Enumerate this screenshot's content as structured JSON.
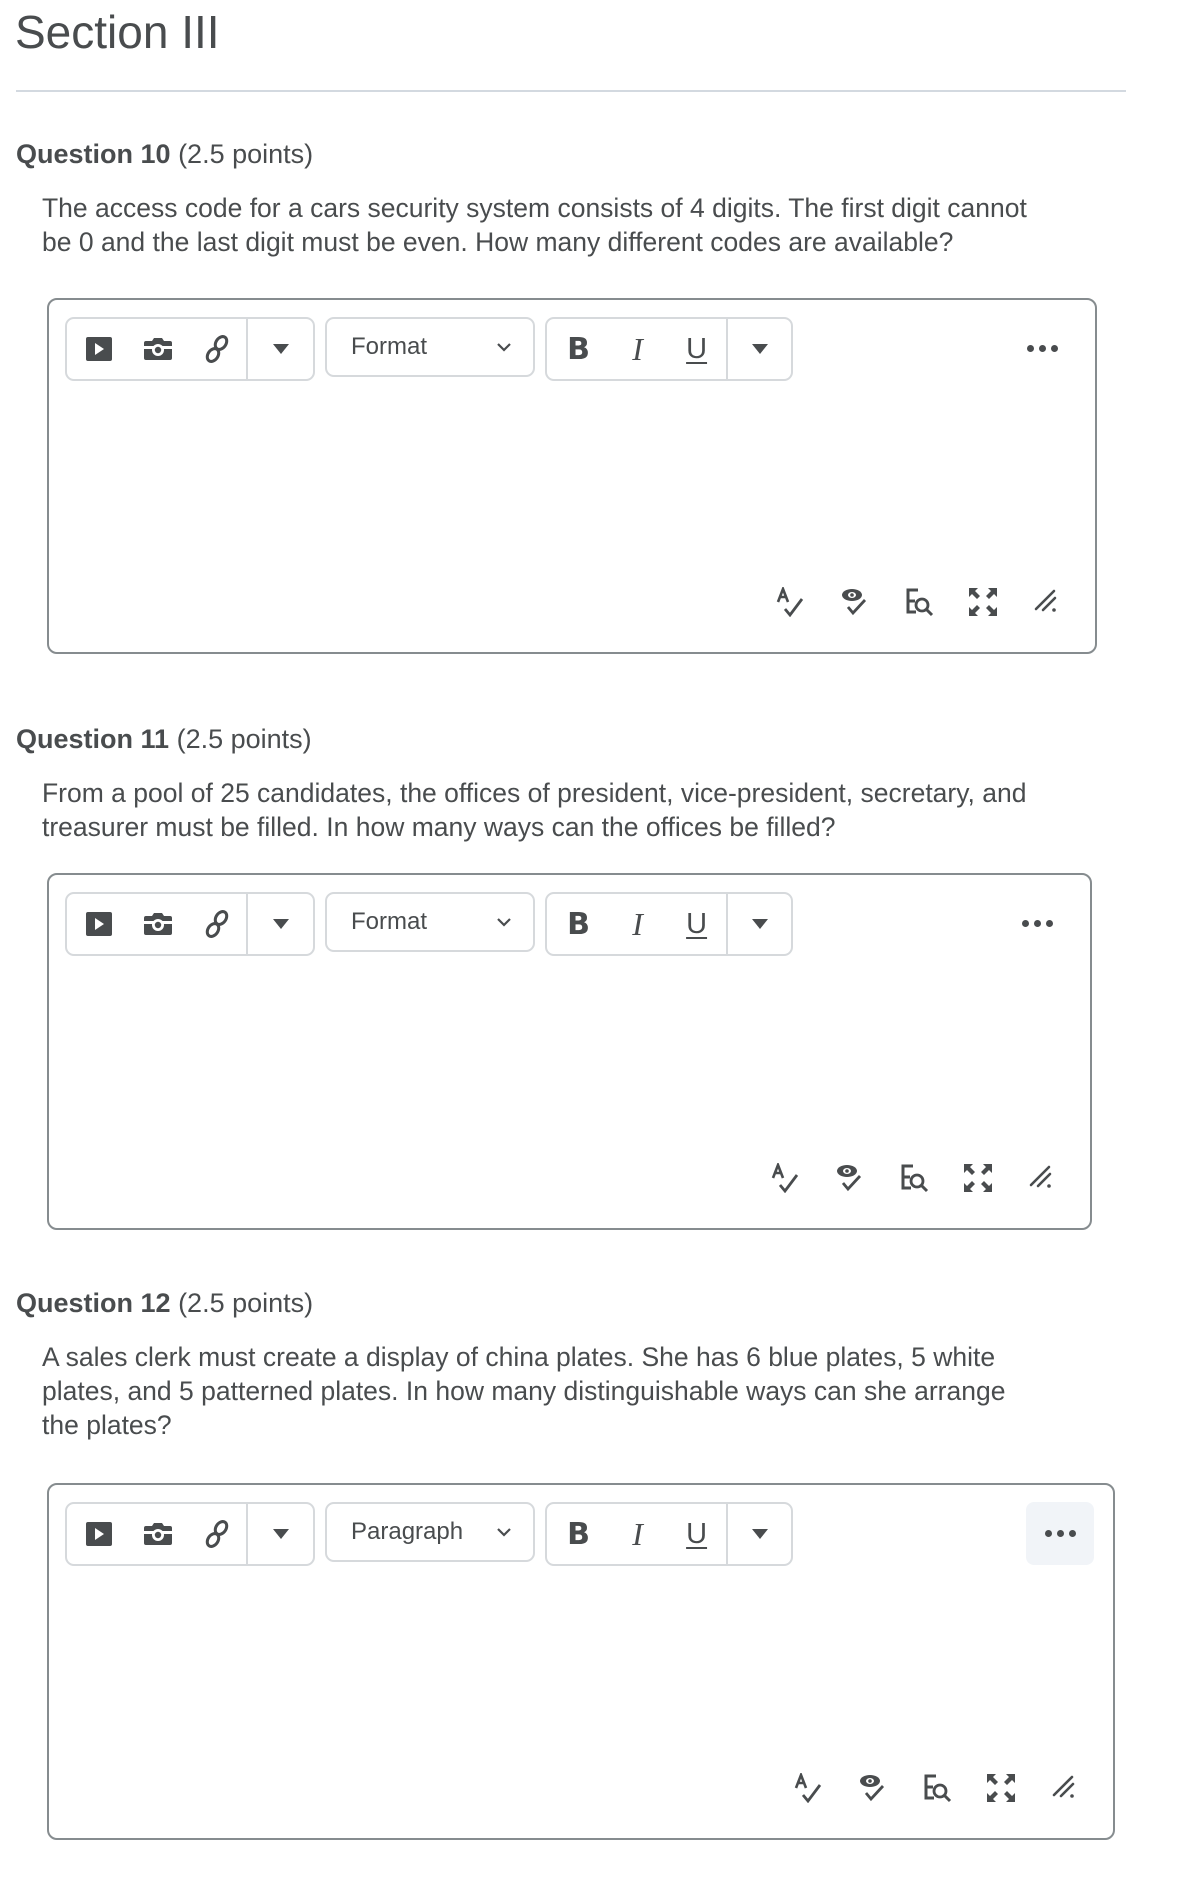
{
  "section": {
    "title": "Section III"
  },
  "questions": [
    {
      "number_label": "Question 10",
      "points_label": "(2.5 points)",
      "text_lines": [
        "The access code for a cars security system consists of 4 digits.  The first digit cannot",
        "be 0 and the last digit must be even. How many different codes are available?"
      ],
      "editor": {
        "block_format": "Format",
        "more_active": false
      }
    },
    {
      "number_label": "Question 11",
      "points_label": "(2.5 points)",
      "text_lines": [
        "From a pool of 25 candidates, the offices of president, vice-president, secretary, and",
        "treasurer must be filled. In how many ways can the offices be filled?"
      ],
      "editor": {
        "block_format": "Format",
        "more_active": false
      }
    },
    {
      "number_label": "Question 12",
      "points_label": "(2.5 points)",
      "text_lines": [
        "A sales clerk must create a display of china plates.  She has 6 blue plates, 5 white",
        "plates, and 5 patterned plates.  In how many distinguishable ways can she arrange",
        "the plates?"
      ],
      "editor": {
        "block_format": "Paragraph",
        "more_active": true
      }
    }
  ],
  "toolbar": {
    "insert_icons": [
      "video-icon",
      "camera-icon",
      "link-icon"
    ],
    "bold_label": "B",
    "italic_label": "I",
    "underline_label": "U"
  },
  "status_icons": [
    "spellcheck-icon",
    "accessibility-check-icon",
    "find-replace-icon",
    "fullscreen-icon",
    "resize-handle-icon"
  ],
  "colors": {
    "text": "#494c4e",
    "divider": "#d3d9e0",
    "editor_border": "#868c8f",
    "toolbar_border": "#d6d9dc",
    "more_active_bg": "#f1f4f8"
  }
}
